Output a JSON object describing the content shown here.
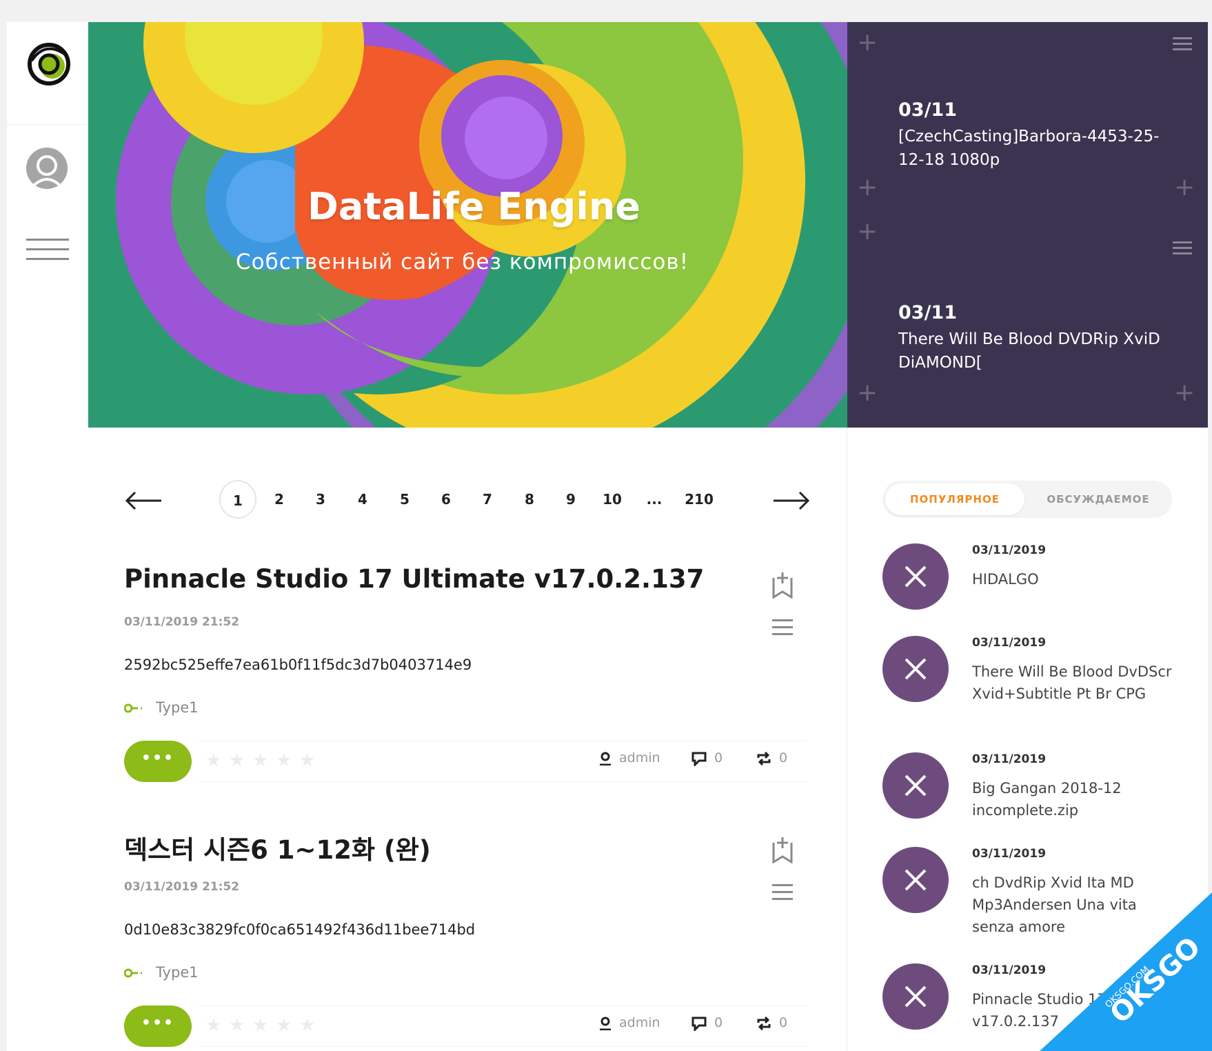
{
  "hero": {
    "title": "DataLife Engine",
    "subtitle": "Собственный сайт без компромиссов!"
  },
  "feed": [
    {
      "date": "03/11",
      "title": "[CzechCasting]Barbora-4453-25-12-18 1080p"
    },
    {
      "date": "03/11",
      "title": "There Will Be Blood DVDRip XviD DiAMOND["
    }
  ],
  "pagination": {
    "pages": [
      "1",
      "2",
      "3",
      "4",
      "5",
      "6",
      "7",
      "8",
      "9",
      "10",
      "...",
      "210"
    ],
    "current": "1"
  },
  "articles": [
    {
      "title": "Pinnacle Studio 17 Ultimate v17.0.2.137",
      "date": "03/11/2019 21:52",
      "hash": "2592bc525effe7ea61b0f11f5dc3d7b0403714e9",
      "category": "Type1",
      "more_label": "•••",
      "author": "admin",
      "comments": "0",
      "reposts": "0"
    },
    {
      "title": "덱스터 시즌6 1~12화 (완)",
      "date": "03/11/2019 21:52",
      "hash": "0d10e83c3829fc0f0ca651492f436d11bee714bd",
      "category": "Type1",
      "more_label": "•••",
      "author": "admin",
      "comments": "0",
      "reposts": "0"
    }
  ],
  "tabs": {
    "popular": "ПОПУЛЯРНОЕ",
    "discussed": "ОБСУЖДАЕМОЕ"
  },
  "popular": [
    {
      "date": "03/11/2019",
      "title": "HIDALGO"
    },
    {
      "date": "03/11/2019",
      "title": "There Will Be Blood DvDScr Xvid+Subtitle Pt Br CPG"
    },
    {
      "date": "03/11/2019",
      "title": "Big Gangan 2018-12 incomplete.zip"
    },
    {
      "date": "03/11/2019",
      "title": "ch DvdRip Xvid Ita MD Mp3Andersen Una vita senza amore"
    },
    {
      "date": "03/11/2019",
      "title": "Pinnacle Studio 17 Ultimate v17.0.2.137"
    }
  ],
  "watermark": {
    "brand": "OKSGO",
    "domain": "OKSGO.COM"
  },
  "colors": {
    "accent_green": "#8dbb18",
    "feed_bg": "#3b3450",
    "circle_purple": "#6d4c7d",
    "tab_active": "#f08a21",
    "watermark_blue": "#1da1f2"
  },
  "icons": [
    "logo-icon",
    "user-icon",
    "menu-icon",
    "arrow-left-icon",
    "arrow-right-icon",
    "bookmark-icon",
    "list-icon",
    "key-icon",
    "star-icon",
    "user-small-icon",
    "comment-icon",
    "repost-icon",
    "close-icon"
  ]
}
